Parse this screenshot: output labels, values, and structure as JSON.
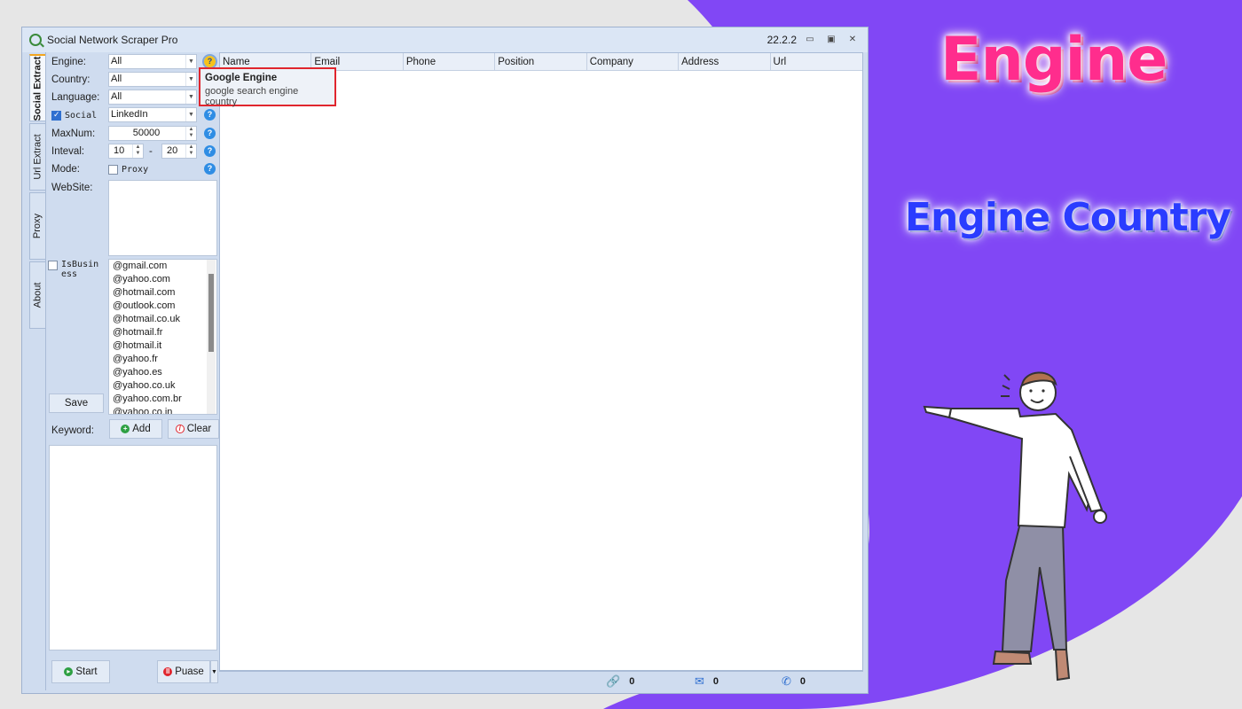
{
  "overlay": {
    "headline": "Engine",
    "subheadline": "Engine Country"
  },
  "window": {
    "title": "Social Network Scraper Pro",
    "version": "22.2.2"
  },
  "tabs": [
    "Social Extract",
    "Url Extract",
    "Proxy",
    "About"
  ],
  "form": {
    "engine_label": "Engine:",
    "engine_value": "All",
    "country_label": "Country:",
    "country_value": "All",
    "language_label": "Language:",
    "language_value": "All",
    "social_label": "Social",
    "social_value": "LinkedIn",
    "maxnum_label": "MaxNum:",
    "maxnum_value": "50000",
    "inteval_label": "Inteval:",
    "inteval_from": "10",
    "inteval_sep": "-",
    "inteval_to": "20",
    "mode_label": "Mode:",
    "proxy_label": "Proxy",
    "website_label": "WebSite:",
    "isbusiness_label": "IsBusiness",
    "save_label": "Save",
    "keyword_label": "Keyword:",
    "add_label": "Add",
    "clear_label": "Clear",
    "start_label": "Start",
    "pause_label": "Puase"
  },
  "email_domains": [
    "@gmail.com",
    "@yahoo.com",
    "@hotmail.com",
    "@outlook.com",
    "@hotmail.co.uk",
    "@hotmail.fr",
    "@hotmail.it",
    "@yahoo.fr",
    "@yahoo.es",
    "@yahoo.co.uk",
    "@yahoo.com.br",
    "@yahoo.co.in"
  ],
  "grid": {
    "columns": [
      "Name",
      "Email",
      "Phone",
      "Position",
      "Company",
      "Address",
      "Url"
    ]
  },
  "tooltip": {
    "title": "Google Engine",
    "text": "google search engine country"
  },
  "status": {
    "links": "0",
    "emails": "0",
    "phones": "0"
  },
  "colors": {
    "purple": "#8147f5",
    "headline": "#ff2d8d",
    "subheadline": "#2a3cff",
    "highlight": "#e0262e"
  }
}
